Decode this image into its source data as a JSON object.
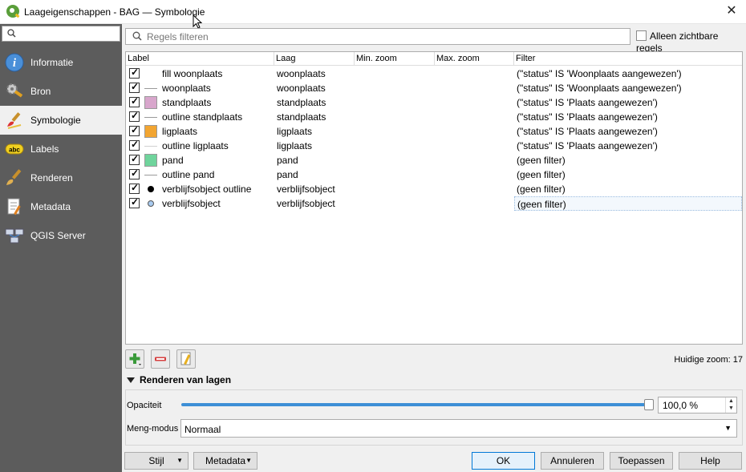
{
  "window": {
    "title": "Laageigenschappen - BAG — Symbologie",
    "close_icon": "close-icon"
  },
  "sidebar": {
    "search_placeholder": "",
    "items": [
      {
        "label": "Informatie",
        "icon": "info-icon"
      },
      {
        "label": "Bron",
        "icon": "source-icon"
      },
      {
        "label": "Symbologie",
        "icon": "paintbrush-icon",
        "active": true
      },
      {
        "label": "Labels",
        "icon": "labels-abc-icon"
      },
      {
        "label": "Renderen",
        "icon": "rendering-brush-icon"
      },
      {
        "label": "Metadata",
        "icon": "metadata-icon"
      },
      {
        "label": "QGIS Server",
        "icon": "server-icon"
      }
    ]
  },
  "toolbar": {
    "filter_placeholder": "Regels filteren",
    "only_visible_label": "Alleen zichtbare regels",
    "only_visible_checked": false
  },
  "table": {
    "headers": [
      "Label",
      "Laag",
      "Min. zoom",
      "Max. zoom",
      "Filter"
    ],
    "rows": [
      {
        "checked": true,
        "symbol": "none",
        "label": "fill woonplaats",
        "layer": "woonplaats",
        "min": "",
        "max": "",
        "filter": "(\"status\" IS 'Woonplaats aangewezen')"
      },
      {
        "checked": true,
        "symbol": "line-gray",
        "label": "woonplaats",
        "layer": "woonplaats",
        "min": "",
        "max": "",
        "filter": "(\"status\" IS 'Woonplaats aangewezen')"
      },
      {
        "checked": true,
        "symbol": "fill-pink",
        "label": "standplaats",
        "layer": "standplaats",
        "min": "",
        "max": "",
        "filter": "(\"status\" IS 'Plaats aangewezen')"
      },
      {
        "checked": true,
        "symbol": "line-gray",
        "label": "outline standplaats",
        "layer": "standplaats",
        "min": "",
        "max": "",
        "filter": "(\"status\" IS 'Plaats aangewezen')"
      },
      {
        "checked": true,
        "symbol": "fill-orange",
        "label": "ligplaats",
        "layer": "ligplaats",
        "min": "",
        "max": "",
        "filter": "(\"status\" IS 'Plaats aangewezen')"
      },
      {
        "checked": true,
        "symbol": "line-light",
        "label": "outline ligplaats",
        "layer": "ligplaats",
        "min": "",
        "max": "",
        "filter": "(\"status\" IS 'Plaats aangewezen')"
      },
      {
        "checked": true,
        "symbol": "fill-green",
        "label": "pand",
        "layer": "pand",
        "min": "",
        "max": "",
        "filter": "(geen filter)"
      },
      {
        "checked": true,
        "symbol": "line-gray",
        "label": "outline pand",
        "layer": "pand",
        "min": "",
        "max": "",
        "filter": "(geen filter)"
      },
      {
        "checked": true,
        "symbol": "dot-black",
        "label": "verblijfsobject outline",
        "layer": "verblijfsobject",
        "min": "",
        "max": "",
        "filter": "(geen filter)"
      },
      {
        "checked": true,
        "symbol": "dot-blue",
        "label": "verblijfsobject",
        "layer": "verblijfsobject",
        "min": "",
        "max": "",
        "filter": "(geen filter)",
        "selected": true
      }
    ]
  },
  "symbol_colors": {
    "fill-pink": "#d8a6cc",
    "fill-orange": "#f2a531",
    "fill-green": "#6fd49c",
    "dot-blue": "#a9cbf0",
    "slider": "#3d8fd6"
  },
  "rule_tools": {
    "add": "add-rule-icon",
    "remove": "remove-rule-icon",
    "edit": "edit-rule-icon"
  },
  "zoom_label": "Huidige zoom: 17",
  "rendering": {
    "title": "Renderen van lagen",
    "opacity_label": "Opaciteit",
    "opacity_value": "100,0 %",
    "opacity_fraction": 1.0,
    "blend_label": "Meng-modus",
    "blend_value": "Normaal"
  },
  "buttons": {
    "style": "Stijl",
    "metadata": "Metadata",
    "ok": "OK",
    "cancel": "Annuleren",
    "apply": "Toepassen",
    "help": "Help"
  }
}
